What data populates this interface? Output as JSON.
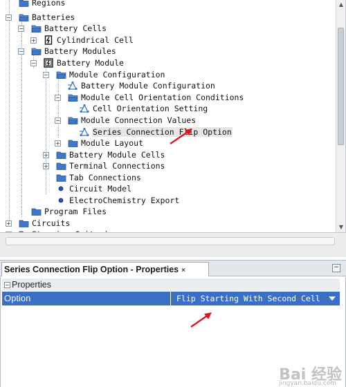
{
  "tree": {
    "items": [
      {
        "label": "Regions",
        "icon": "folder-icon",
        "toggle": ""
      },
      {
        "label": "Batteries",
        "icon": "folder-open-icon",
        "toggle": "−"
      },
      {
        "label": "Battery Cells",
        "icon": "folder-open-icon",
        "toggle": "−"
      },
      {
        "label": "Cylindrical Cell",
        "icon": "battery-cell-icon",
        "toggle": "+"
      },
      {
        "label": "Battery Modules",
        "icon": "folder-open-icon",
        "toggle": "−"
      },
      {
        "label": "Battery Module",
        "icon": "battery-module-icon",
        "toggle": "−"
      },
      {
        "label": "Module Configuration",
        "icon": "folder-open-icon",
        "toggle": "−"
      },
      {
        "label": "Battery Module Configuration",
        "icon": "property-node-icon",
        "toggle": ""
      },
      {
        "label": "Module Cell Orientation Conditions",
        "icon": "folder-open-icon",
        "toggle": "−"
      },
      {
        "label": "Cell Orientation Setting",
        "icon": "property-node-icon",
        "toggle": ""
      },
      {
        "label": "Module Connection Values",
        "icon": "folder-open-icon",
        "toggle": "−"
      },
      {
        "label": "Series Connection Flip Option",
        "icon": "property-node-icon",
        "toggle": ""
      },
      {
        "label": "Module Layout",
        "icon": "folder-icon",
        "toggle": "+"
      },
      {
        "label": "Battery Module Cells",
        "icon": "folder-icon",
        "toggle": "+"
      },
      {
        "label": "Terminal Connections",
        "icon": "folder-icon",
        "toggle": "+"
      },
      {
        "label": "Tab Connections",
        "icon": "folder-icon",
        "toggle": ""
      },
      {
        "label": "Circuit Model",
        "icon": "blue-dot-icon",
        "toggle": ""
      },
      {
        "label": "ElectroChemistry Export",
        "icon": "blue-dot-icon",
        "toggle": ""
      },
      {
        "label": "Program Files",
        "icon": "folder-icon",
        "toggle": ""
      },
      {
        "label": "Circuits",
        "icon": "folder-icon",
        "toggle": "+"
      },
      {
        "label": "Stopping Criteria",
        "icon": "folder-icon",
        "toggle": "+"
      }
    ]
  },
  "properties": {
    "tab_title": "Series Connection Flip Option - Properties",
    "tab_close": "×",
    "minimize": "−",
    "category": "Properties",
    "category_toggle": "−",
    "option_name": "Option",
    "option_value": "Flip Starting With Second Cell"
  },
  "watermark": {
    "text": "Bai 经验",
    "sub": "jingyan.baidu.com"
  },
  "colors": {
    "selection": "#3a6fc4",
    "folder": "#3f78c8",
    "arrow": "#e0141c"
  }
}
